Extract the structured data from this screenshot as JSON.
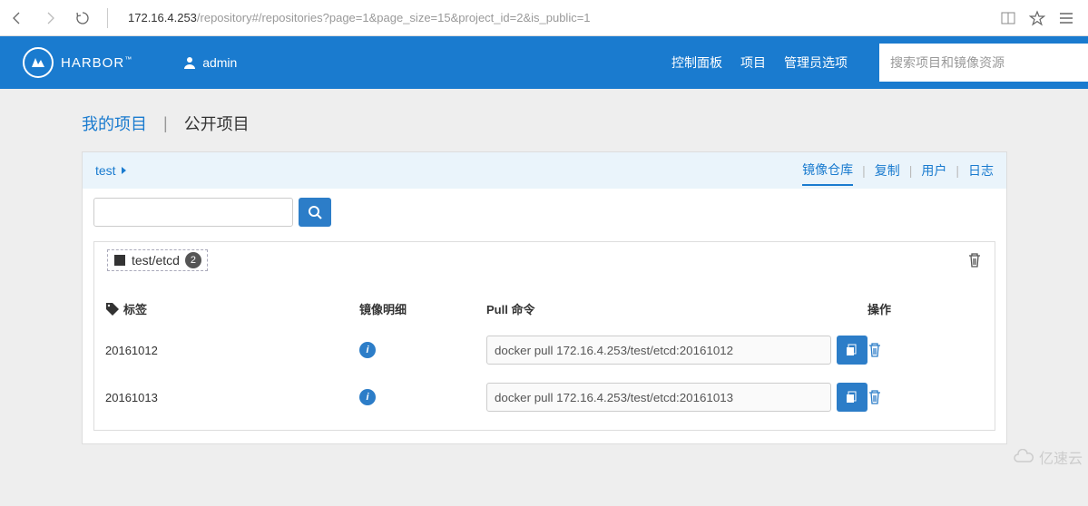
{
  "browser": {
    "url_host": "172.16.4.253",
    "url_path": "/repository#/repositories?page=1&page_size=15&project_id=2&is_public=1"
  },
  "header": {
    "brand": "HARBOR",
    "brand_tm": "™",
    "user_label": "admin",
    "nav": {
      "dashboard": "控制面板",
      "projects": "项目",
      "admin_options": "管理员选项"
    },
    "search_placeholder": "搜索项目和镜像资源"
  },
  "project_tabs": {
    "mine": "我的项目",
    "public": "公开项目"
  },
  "breadcrumb": {
    "project_name": "test",
    "tabs": {
      "repos": "镜像仓库",
      "replication": "复制",
      "users": "用户",
      "logs": "日志"
    }
  },
  "repo": {
    "name": "test/etcd",
    "count": "2"
  },
  "table": {
    "headers": {
      "tag": "标签",
      "detail": "镜像明细",
      "pull_cmd": "Pull 命令",
      "ops": "操作"
    },
    "rows": [
      {
        "tag": "20161012",
        "pull": "docker pull 172.16.4.253/test/etcd:20161012"
      },
      {
        "tag": "20161013",
        "pull": "docker pull 172.16.4.253/test/etcd:20161013"
      }
    ]
  },
  "watermark": "亿速云"
}
